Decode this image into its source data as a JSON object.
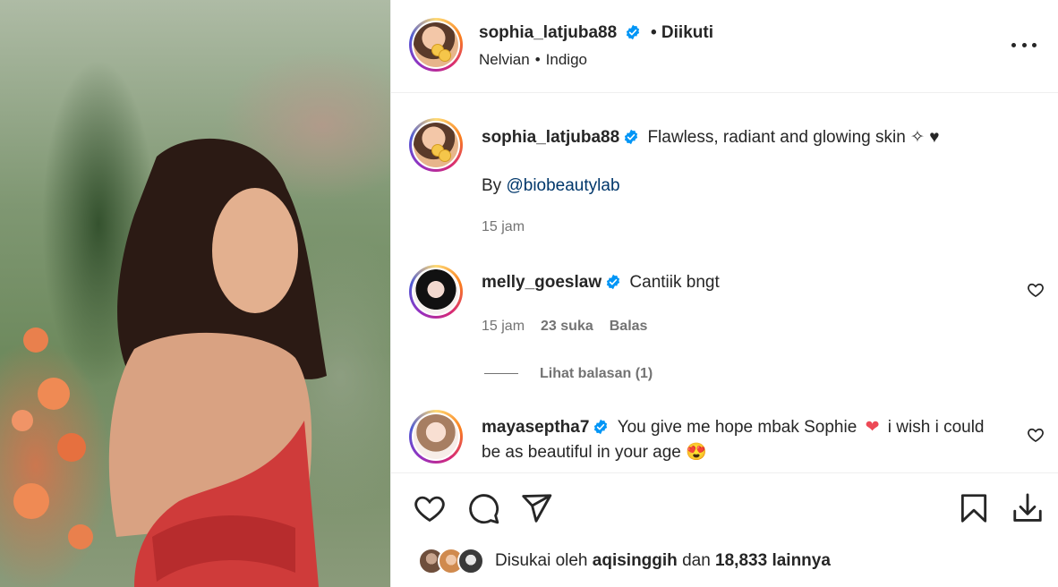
{
  "post": {
    "author": "sophia_latjuba88",
    "follow_status": "• Diikuti",
    "audio_artist": "Nelvian",
    "audio_title": "Indigo"
  },
  "caption": {
    "username": "sophia_latjuba88",
    "text": "Flawless, radiant and glowing skin ✧ ♥",
    "by_prefix": "By",
    "mention": "@biobeautylab",
    "time": "15 jam"
  },
  "comments": [
    {
      "username": "melly_goeslaw",
      "text": "Cantiik bngt",
      "time": "15 jam",
      "likes": "23 suka",
      "reply": "Balas",
      "view_replies": "Lihat balasan (1)"
    },
    {
      "username": "mayaseptha7",
      "text_a": "You give me hope mbak Sophie",
      "emoji_a": "❤",
      "text_b": " i wish i could be as beautiful in your age",
      "emoji_b": "😍"
    }
  ],
  "likes_bar": {
    "prefix": "Disukai oleh",
    "user": "aqisinggih",
    "mid": "dan",
    "count": "18,833 lainnya"
  },
  "icons": {
    "verified": "verified-badge-icon",
    "like": "heart-icon",
    "comment": "comment-icon",
    "share": "share-icon",
    "save": "bookmark-icon",
    "download": "download-icon",
    "more": "more-options-icon"
  },
  "colors": {
    "verified": "#0095f6",
    "link": "#00376b",
    "heart": "#ed4956"
  }
}
